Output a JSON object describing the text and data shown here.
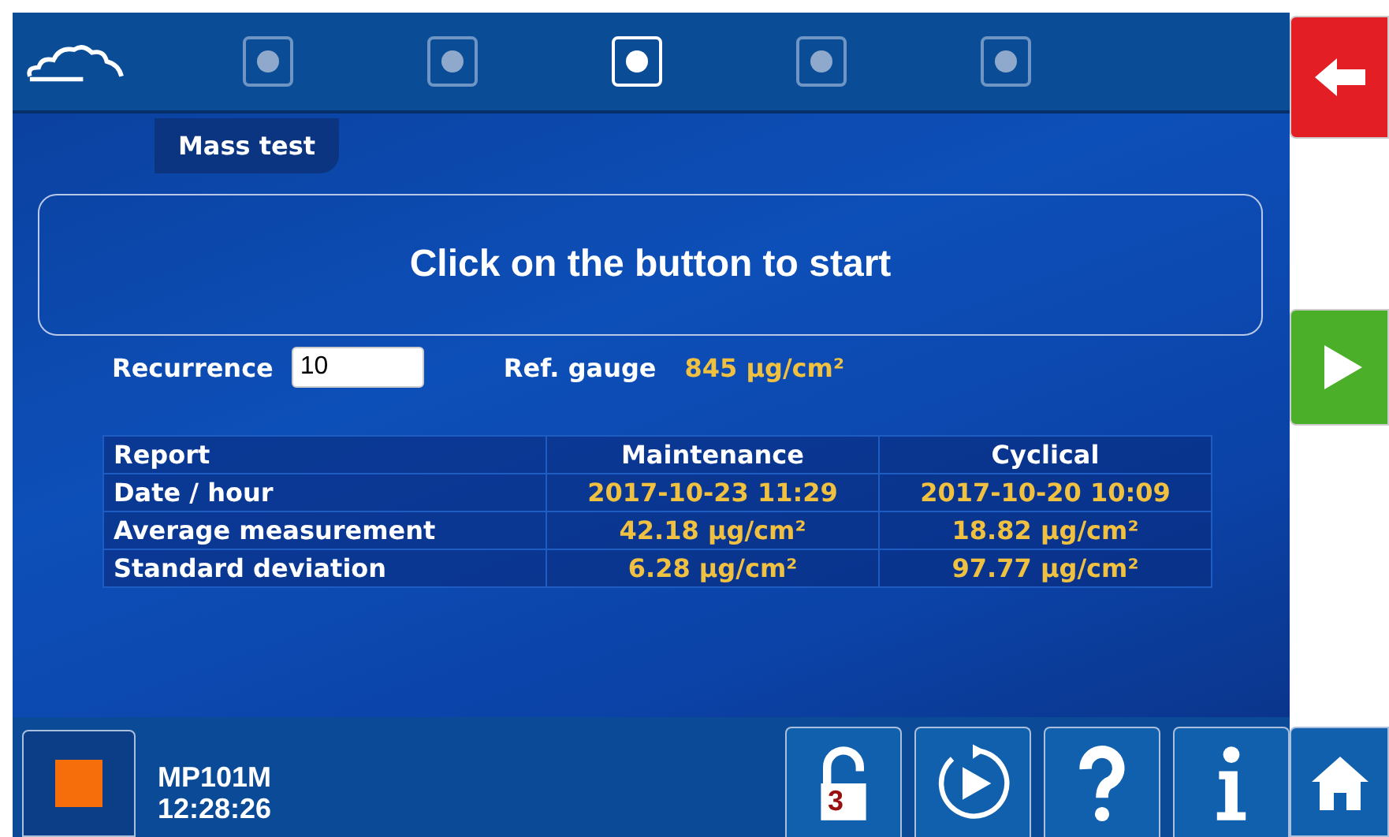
{
  "steps": [
    {
      "selected": false
    },
    {
      "selected": false
    },
    {
      "selected": true
    },
    {
      "selected": false
    },
    {
      "selected": false
    }
  ],
  "tab": {
    "label": "Mass test"
  },
  "message": "Click on the button to start",
  "recurrence": {
    "label": "Recurrence",
    "value": "10"
  },
  "ref_gauge": {
    "label": "Ref. gauge",
    "value": "845 µg/cm²"
  },
  "table": {
    "columns": [
      "Report",
      "Maintenance",
      "Cyclical"
    ],
    "rows": [
      [
        "Date / hour",
        "2017-10-23 11:29",
        "2017-10-20 10:09"
      ],
      [
        "Average measurement",
        "42.18 µg/cm²",
        "18.82 µg/cm²"
      ],
      [
        "Standard deviation",
        "6.28 µg/cm²",
        "97.77 µg/cm²"
      ]
    ]
  },
  "status": {
    "device": "MP101M",
    "time": "12:28:26"
  },
  "lock_level": "3"
}
